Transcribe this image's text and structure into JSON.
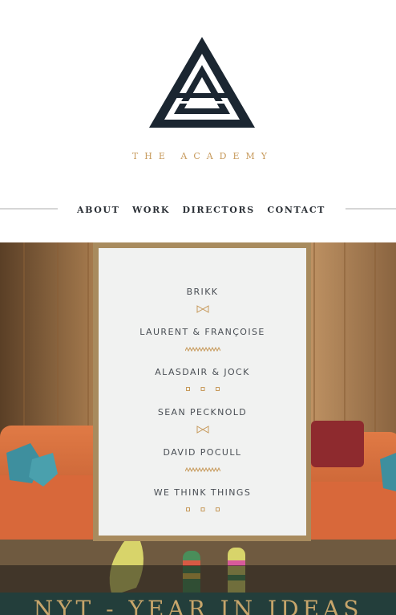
{
  "brand": {
    "name": "THE ACADEMY",
    "logo_icon": "triangle-a-logo-icon"
  },
  "nav": {
    "items": [
      "ABOUT",
      "WORK",
      "DIRECTORS",
      "CONTACT"
    ]
  },
  "directors_menu": {
    "items": [
      {
        "label": "BRIKK",
        "separator_icon": "bowtie-icon"
      },
      {
        "label": "LAURENT & FRANÇOISE",
        "separator_icon": "zigzag-icon"
      },
      {
        "label": "ALASDAIR & JOCK",
        "separator_icon": "three-squares-icon"
      },
      {
        "label": "SEAN PECKNOLD",
        "separator_icon": "bowtie-icon"
      },
      {
        "label": "DAVID POCULL",
        "separator_icon": "zigzag-icon"
      },
      {
        "label": "WE THINK THINGS",
        "separator_icon": "three-squares-icon"
      }
    ]
  },
  "hero": {
    "title": "NYT - YEAR IN IDEAS"
  },
  "colors": {
    "navy": "#1b2631",
    "gold": "#c79a5c",
    "panel": "#f1f2f1",
    "frame": "#a88b5e"
  }
}
